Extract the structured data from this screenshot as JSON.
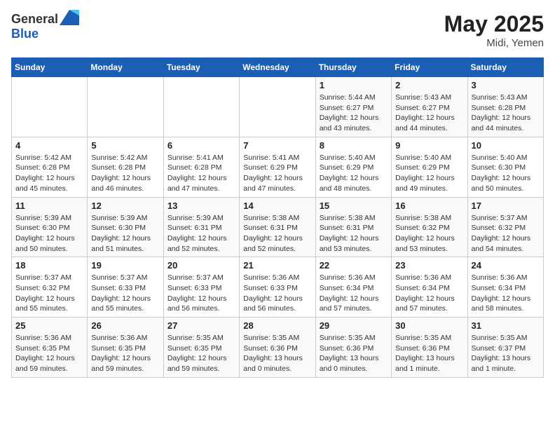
{
  "header": {
    "logo_general": "General",
    "logo_blue": "Blue",
    "month_year": "May 2025",
    "location": "Midi, Yemen"
  },
  "weekdays": [
    "Sunday",
    "Monday",
    "Tuesday",
    "Wednesday",
    "Thursday",
    "Friday",
    "Saturday"
  ],
  "weeks": [
    [
      {
        "day": "",
        "info": ""
      },
      {
        "day": "",
        "info": ""
      },
      {
        "day": "",
        "info": ""
      },
      {
        "day": "",
        "info": ""
      },
      {
        "day": "1",
        "info": "Sunrise: 5:44 AM\nSunset: 6:27 PM\nDaylight: 12 hours\nand 43 minutes."
      },
      {
        "day": "2",
        "info": "Sunrise: 5:43 AM\nSunset: 6:27 PM\nDaylight: 12 hours\nand 44 minutes."
      },
      {
        "day": "3",
        "info": "Sunrise: 5:43 AM\nSunset: 6:28 PM\nDaylight: 12 hours\nand 44 minutes."
      }
    ],
    [
      {
        "day": "4",
        "info": "Sunrise: 5:42 AM\nSunset: 6:28 PM\nDaylight: 12 hours\nand 45 minutes."
      },
      {
        "day": "5",
        "info": "Sunrise: 5:42 AM\nSunset: 6:28 PM\nDaylight: 12 hours\nand 46 minutes."
      },
      {
        "day": "6",
        "info": "Sunrise: 5:41 AM\nSunset: 6:28 PM\nDaylight: 12 hours\nand 47 minutes."
      },
      {
        "day": "7",
        "info": "Sunrise: 5:41 AM\nSunset: 6:29 PM\nDaylight: 12 hours\nand 47 minutes."
      },
      {
        "day": "8",
        "info": "Sunrise: 5:40 AM\nSunset: 6:29 PM\nDaylight: 12 hours\nand 48 minutes."
      },
      {
        "day": "9",
        "info": "Sunrise: 5:40 AM\nSunset: 6:29 PM\nDaylight: 12 hours\nand 49 minutes."
      },
      {
        "day": "10",
        "info": "Sunrise: 5:40 AM\nSunset: 6:30 PM\nDaylight: 12 hours\nand 50 minutes."
      }
    ],
    [
      {
        "day": "11",
        "info": "Sunrise: 5:39 AM\nSunset: 6:30 PM\nDaylight: 12 hours\nand 50 minutes."
      },
      {
        "day": "12",
        "info": "Sunrise: 5:39 AM\nSunset: 6:30 PM\nDaylight: 12 hours\nand 51 minutes."
      },
      {
        "day": "13",
        "info": "Sunrise: 5:39 AM\nSunset: 6:31 PM\nDaylight: 12 hours\nand 52 minutes."
      },
      {
        "day": "14",
        "info": "Sunrise: 5:38 AM\nSunset: 6:31 PM\nDaylight: 12 hours\nand 52 minutes."
      },
      {
        "day": "15",
        "info": "Sunrise: 5:38 AM\nSunset: 6:31 PM\nDaylight: 12 hours\nand 53 minutes."
      },
      {
        "day": "16",
        "info": "Sunrise: 5:38 AM\nSunset: 6:32 PM\nDaylight: 12 hours\nand 53 minutes."
      },
      {
        "day": "17",
        "info": "Sunrise: 5:37 AM\nSunset: 6:32 PM\nDaylight: 12 hours\nand 54 minutes."
      }
    ],
    [
      {
        "day": "18",
        "info": "Sunrise: 5:37 AM\nSunset: 6:32 PM\nDaylight: 12 hours\nand 55 minutes."
      },
      {
        "day": "19",
        "info": "Sunrise: 5:37 AM\nSunset: 6:33 PM\nDaylight: 12 hours\nand 55 minutes."
      },
      {
        "day": "20",
        "info": "Sunrise: 5:37 AM\nSunset: 6:33 PM\nDaylight: 12 hours\nand 56 minutes."
      },
      {
        "day": "21",
        "info": "Sunrise: 5:36 AM\nSunset: 6:33 PM\nDaylight: 12 hours\nand 56 minutes."
      },
      {
        "day": "22",
        "info": "Sunrise: 5:36 AM\nSunset: 6:34 PM\nDaylight: 12 hours\nand 57 minutes."
      },
      {
        "day": "23",
        "info": "Sunrise: 5:36 AM\nSunset: 6:34 PM\nDaylight: 12 hours\nand 57 minutes."
      },
      {
        "day": "24",
        "info": "Sunrise: 5:36 AM\nSunset: 6:34 PM\nDaylight: 12 hours\nand 58 minutes."
      }
    ],
    [
      {
        "day": "25",
        "info": "Sunrise: 5:36 AM\nSunset: 6:35 PM\nDaylight: 12 hours\nand 59 minutes."
      },
      {
        "day": "26",
        "info": "Sunrise: 5:36 AM\nSunset: 6:35 PM\nDaylight: 12 hours\nand 59 minutes."
      },
      {
        "day": "27",
        "info": "Sunrise: 5:35 AM\nSunset: 6:35 PM\nDaylight: 12 hours\nand 59 minutes."
      },
      {
        "day": "28",
        "info": "Sunrise: 5:35 AM\nSunset: 6:36 PM\nDaylight: 13 hours\nand 0 minutes."
      },
      {
        "day": "29",
        "info": "Sunrise: 5:35 AM\nSunset: 6:36 PM\nDaylight: 13 hours\nand 0 minutes."
      },
      {
        "day": "30",
        "info": "Sunrise: 5:35 AM\nSunset: 6:36 PM\nDaylight: 13 hours\nand 1 minute."
      },
      {
        "day": "31",
        "info": "Sunrise: 5:35 AM\nSunset: 6:37 PM\nDaylight: 13 hours\nand 1 minute."
      }
    ]
  ]
}
